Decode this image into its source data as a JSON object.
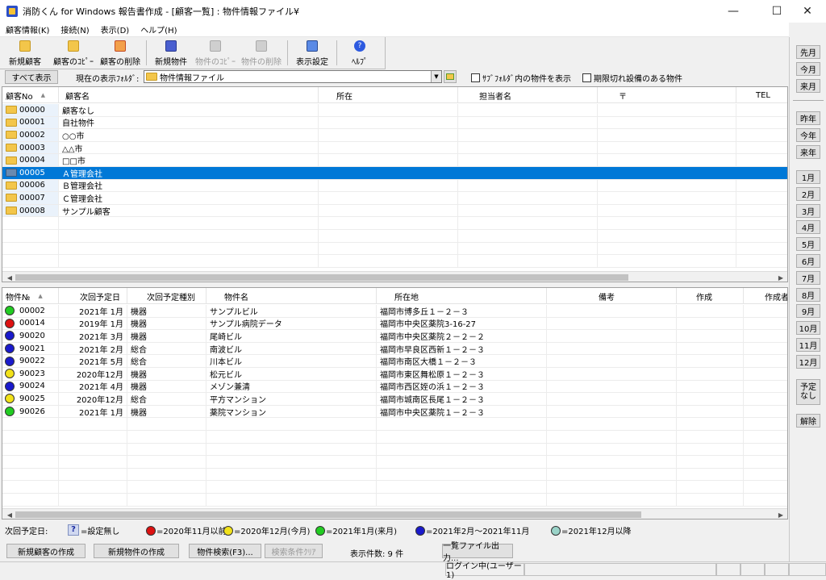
{
  "window": {
    "title": "消防くん for Windows 報告書作成 - [顧客一覧] : 物件情報ファイル¥",
    "minimize": "—",
    "maximize": "☐",
    "close": "✕"
  },
  "menu": [
    "顧客情報(K)",
    "接続(N)",
    "表示(D)",
    "ヘルプ(H)"
  ],
  "toolbar": {
    "new_customer": "新規顧客",
    "copy_customer": "顧客のｺﾋﾟｰ",
    "delete_customer": "顧客の削除",
    "new_property": "新規物件",
    "copy_property": "物件のｺﾋﾟｰ",
    "delete_property": "物件の削除",
    "display_settings": "表示設定",
    "help": "ﾍﾙﾌﾟ"
  },
  "filter": {
    "show_all": "すべて表示",
    "folder_label": "現在の表示ﾌｫﾙﾀﾞ:",
    "folder_value": "物件情報ファイル",
    "subfolder_check": "ｻﾌﾞﾌｫﾙﾀﾞ内の物件を表示",
    "expired_check": "期限切れ設備のある物件"
  },
  "customers": {
    "columns": [
      "顧客No",
      "顧客名",
      "所在",
      "担当者名",
      "〒",
      "TEL"
    ],
    "rows": [
      {
        "no": "00000",
        "name": "顧客なし"
      },
      {
        "no": "00001",
        "name": "自社物件"
      },
      {
        "no": "00002",
        "name": "○○市"
      },
      {
        "no": "00003",
        "name": "△△市"
      },
      {
        "no": "00004",
        "name": "□□市"
      },
      {
        "no": "00005",
        "name": "Ａ管理会社"
      },
      {
        "no": "00006",
        "name": "Ｂ管理会社"
      },
      {
        "no": "00007",
        "name": "Ｃ管理会社"
      },
      {
        "no": "00008",
        "name": "サンプル顧客"
      }
    ],
    "selected_index": 5
  },
  "properties": {
    "columns": [
      "物件№",
      "次回予定日",
      "次回予定種別",
      "物件名",
      "所在地",
      "備考",
      "作成",
      "作成者"
    ],
    "rows": [
      {
        "color": "#22cc22",
        "no": "00002",
        "date": "2021年 1月",
        "type": "機器",
        "name": "サンプルビル",
        "address": "福岡市博多丘１－２－３"
      },
      {
        "color": "#dd1111",
        "no": "00014",
        "date": "2019年 1月",
        "type": "機器",
        "name": "サンプル病院データ",
        "address": "福岡市中央区薬院3-16-27"
      },
      {
        "color": "#1a1acc",
        "no": "90020",
        "date": "2021年 3月",
        "type": "機器",
        "name": "尾崎ビル",
        "address": "福岡市中央区薬院２－２－２"
      },
      {
        "color": "#1a1acc",
        "no": "90021",
        "date": "2021年 2月",
        "type": "総合",
        "name": "南波ビル",
        "address": "福岡市早良区西新１－２－３"
      },
      {
        "color": "#1a1acc",
        "no": "90022",
        "date": "2021年 5月",
        "type": "総合",
        "name": "川本ビル",
        "address": "福岡市南区大橋１－２－３"
      },
      {
        "color": "#f2e21a",
        "no": "90023",
        "date": "2020年12月",
        "type": "機器",
        "name": "松元ビル",
        "address": "福岡市東区舞松原１－２－３"
      },
      {
        "color": "#1a1acc",
        "no": "90024",
        "date": "2021年 4月",
        "type": "機器",
        "name": "メゾン兼清",
        "address": "福岡市西区姪の浜１－２－３"
      },
      {
        "color": "#f2e21a",
        "no": "90025",
        "date": "2020年12月",
        "type": "総合",
        "name": "平方マンション",
        "address": "福岡市城南区長尾１－２－３"
      },
      {
        "color": "#22cc22",
        "no": "90026",
        "date": "2021年 1月",
        "type": "機器",
        "name": "薬院マンション",
        "address": "福岡市中央区薬院１－２－３"
      }
    ]
  },
  "legend": {
    "label": "次回予定日:",
    "items": [
      {
        "icon": "question-icon",
        "text": "=設定無し"
      },
      {
        "color": "#dd1111",
        "text": "=2020年11月以前"
      },
      {
        "color": "#f2e21a",
        "text": "=2020年12月(今月)"
      },
      {
        "color": "#22cc22",
        "text": "=2021年1月(来月)"
      },
      {
        "color": "#1a1acc",
        "text": "=2021年2月～2021年11月"
      },
      {
        "color": "#9ad3c8",
        "text": "=2021年12月以降"
      }
    ]
  },
  "bottom": {
    "new_customer": "新規顧客の作成",
    "new_property": "新規物件の作成",
    "search": "物件検索(F3)...",
    "clear": "検索条件ｸﾘｱ",
    "count": "表示件数: 9 件",
    "export": "一覧ファイル出力..."
  },
  "status": {
    "login": "ログイン中(ユーザー1)"
  },
  "right": {
    "month_group": [
      "先月",
      "今月",
      "来月"
    ],
    "year_group": [
      "昨年",
      "今年",
      "来年"
    ],
    "months": [
      "1月",
      "2月",
      "3月",
      "4月",
      "5月",
      "6月",
      "7月",
      "8月",
      "9月",
      "10月",
      "11月",
      "12月"
    ],
    "none": "予定なし",
    "release": "解除"
  }
}
